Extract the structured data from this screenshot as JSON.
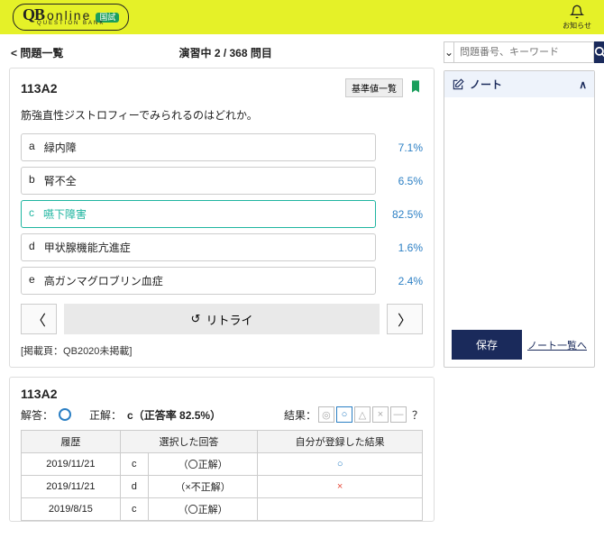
{
  "header": {
    "logo_main": "QB",
    "logo_sub": "online",
    "logo_tag": "QUESTION BANK",
    "badge": "国試",
    "bell": "お知らせ"
  },
  "top": {
    "back": "問題一覧",
    "progress": "演習中 2 / 368 問目"
  },
  "question": {
    "id": "113A2",
    "tagbtn": "基準値一覧",
    "text": "筋強直性ジストロフィーでみられるのはどれか。",
    "choices": [
      {
        "letter": "a",
        "text": "緑内障",
        "pct": "7.1%"
      },
      {
        "letter": "b",
        "text": "腎不全",
        "pct": "6.5%"
      },
      {
        "letter": "c",
        "text": "嚥下障害",
        "pct": "82.5%",
        "correct": true
      },
      {
        "letter": "d",
        "text": "甲状腺機能亢進症",
        "pct": "1.6%"
      },
      {
        "letter": "e",
        "text": "高ガンマグロブリン血症",
        "pct": "2.4%"
      }
    ],
    "retry": "リトライ",
    "pub": "[掲載頁：QB2020未掲載]"
  },
  "answer": {
    "id": "113A2",
    "ans_label": "解答：",
    "correct_label": "正解：",
    "correct_text": "c（正答率 82.5%）",
    "result_label": "結果：",
    "help": "？",
    "table": {
      "h1": "履歴",
      "h2": "選択した回答",
      "h3": "自分が登録した結果",
      "rows": [
        {
          "date": "2019/11/21",
          "ans": "c",
          "mark": "（〇正解）",
          "res": "○",
          "res_color": "#2b7fc4"
        },
        {
          "date": "2019/11/21",
          "ans": "d",
          "mark": "（×不正解）",
          "res": "×",
          "res_color": "#e74c3c"
        },
        {
          "date": "2019/8/15",
          "ans": "c",
          "mark": "（〇正解）",
          "res": "",
          "res_color": ""
        }
      ]
    }
  },
  "side": {
    "search_placeholder": "問題番号、キーワード",
    "note_title": "ノート",
    "save": "保存",
    "list_link": "ノート一覧へ"
  }
}
